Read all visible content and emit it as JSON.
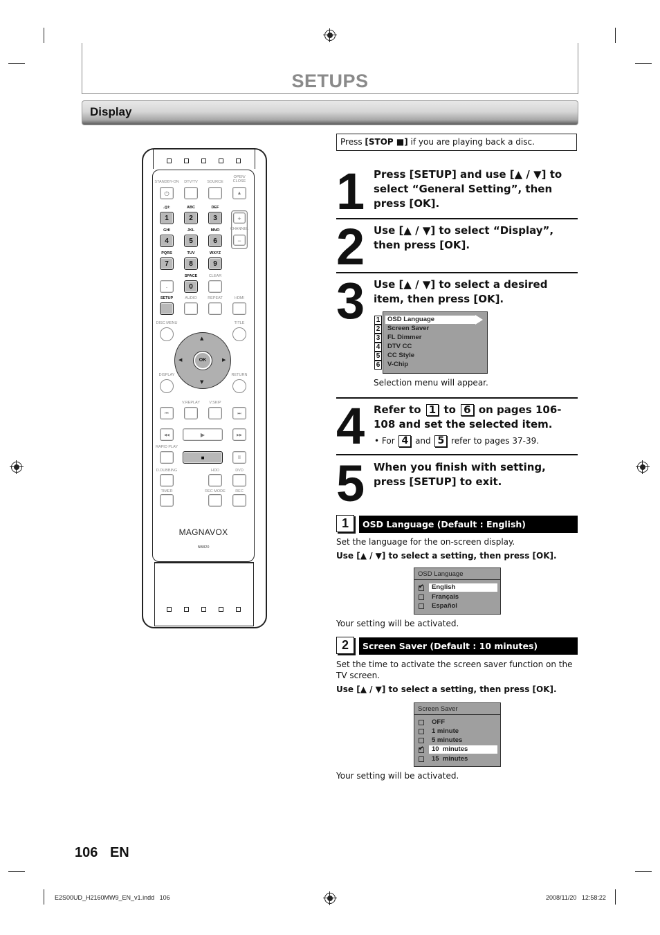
{
  "header": {
    "title": "SETUPS"
  },
  "section": {
    "title": "Display"
  },
  "notice": {
    "prefix": "Press ",
    "key": "[STOP ■]",
    "suffix": " if you are playing back a disc."
  },
  "steps": [
    {
      "num": "1",
      "text": "Press [SETUP] and use [▲ / ▼] to select “General Setting”, then press [OK]."
    },
    {
      "num": "2",
      "text": "Use [▲ / ▼] to select “Display”, then press [OK]."
    },
    {
      "num": "3",
      "text": "Use [▲ / ▼] to select a desired item, then press [OK].",
      "note": "Selection menu will appear."
    },
    {
      "num": "4",
      "text_a": "Refer to",
      "ref1": "1",
      "text_b": "to",
      "ref2": "6",
      "text_c": "on pages 106-108 and set the selected item.",
      "bullet_a": "• For",
      "bref1": "4",
      "bullet_b": "and",
      "bref2": "5",
      "bullet_c": "refer to pages 37-39."
    },
    {
      "num": "5",
      "text": "When you finish with setting, press [SETUP] to exit."
    }
  ],
  "selection_menu": {
    "items": [
      {
        "index": "1",
        "label": "OSD Language",
        "selected": true
      },
      {
        "index": "2",
        "label": "Screen Saver"
      },
      {
        "index": "3",
        "label": "FL Dimmer"
      },
      {
        "index": "4",
        "label": "DTV CC"
      },
      {
        "index": "5",
        "label": "CC Style"
      },
      {
        "index": "6",
        "label": "V-Chip"
      }
    ]
  },
  "settings": [
    {
      "num": "1",
      "title": "OSD Language (Default : English)",
      "description": "Set the language for the on-screen display.",
      "instruction": "Use [▲ / ▼] to select a setting, then press [OK].",
      "popup_title": "OSD Language",
      "options": [
        {
          "label": "English",
          "checked": true
        },
        {
          "label": "Français",
          "checked": false
        },
        {
          "label": "Español",
          "checked": false
        }
      ],
      "result": "Your setting will be activated."
    },
    {
      "num": "2",
      "title": "Screen Saver (Default : 10 minutes)",
      "description": "Set the time to activate the screen saver function on the TV screen.",
      "instruction": "Use [▲ / ▼] to select a setting, then press [OK].",
      "popup_title": "Screen Saver",
      "options": [
        {
          "label": "OFF",
          "checked": false
        },
        {
          "label": "1 minute",
          "checked": false
        },
        {
          "label": "5 minutes",
          "checked": false
        },
        {
          "label": "10  minutes",
          "checked": true
        },
        {
          "label": "15  minutes",
          "checked": false
        }
      ],
      "result": "Your setting will be activated."
    }
  ],
  "remote": {
    "brand": "MAGNAVOX",
    "model": "NB820",
    "labels": {
      "standby": "STANDBY-ON",
      "dtvtv": "DTV/TV",
      "source": "SOURCE",
      "open_close": "OPEN/ CLOSE",
      "k1": ".@/:",
      "k2": "ABC",
      "k3": "DEF",
      "k4": "GHI",
      "k5": "JKL",
      "k6": "MNO",
      "k7": "PQRS",
      "k8": "TUV",
      "k9": "WXYZ",
      "k0": "SPACE",
      "clear": "CLEAR",
      "channel": "CHANNEL",
      "setup": "SETUP",
      "audio": "AUDIO",
      "repeat": "REPEAT",
      "hdmi": "HDMI",
      "disc_menu": "DISC MENU",
      "title": "TITLE",
      "display": "DISPLAY",
      "return": "RETURN",
      "vreplay": "V.REPLAY",
      "vskip": "V.SKIP",
      "rapid_play": "RAPID PLAY",
      "ddubbing": "D.DUBBING",
      "hdd": "HDD",
      "dvd": "DVD",
      "timer": "TIMER",
      "rec_mode": "REC MODE",
      "rec": "REC",
      "ok": "OK"
    },
    "digits": [
      "1",
      "2",
      "3",
      "4",
      "5",
      "6",
      "7",
      "8",
      "9",
      "0"
    ],
    "symbols": {
      "eject": "▲",
      "plus": "+",
      "minus": "−",
      "dot": "·",
      "prev": "⏮",
      "next": "⏭",
      "rew": "◀◀",
      "ffw": "▶▶",
      "play": "▶",
      "stop": "■",
      "pause": "II",
      "up": "▲",
      "down": "▼",
      "left": "◀",
      "right": "▶"
    }
  },
  "page": {
    "number": "106",
    "lang": "EN"
  },
  "footer": {
    "file": "E2S00UD_H2160MW9_EN_v1.indd   106",
    "timestamp": "2008/11/20   12:58:22"
  }
}
